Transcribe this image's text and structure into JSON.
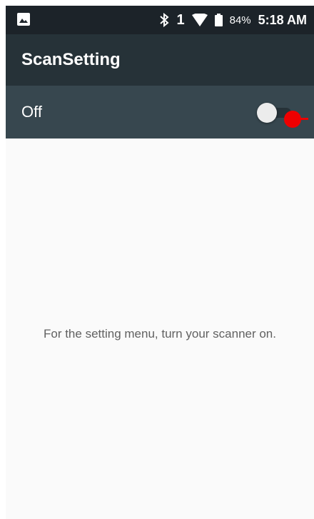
{
  "status_bar": {
    "notification_icon": "gallery-icon",
    "bluetooth_icon": "bluetooth-icon",
    "sim_number": "1",
    "wifi_icon": "wifi-icon",
    "battery_icon": "battery-icon",
    "battery": "84%",
    "time": "5:18 AM"
  },
  "app_bar": {
    "title": "ScanSetting"
  },
  "scanner_switch": {
    "label": "Off",
    "checked": false
  },
  "content": {
    "message": "For the setting menu, turn your scanner on."
  },
  "colors": {
    "status_bar": "#1c2329",
    "app_bar": "#263238",
    "switch_bar": "#37474f",
    "background": "#fafafa",
    "message_text": "#616161",
    "touch_indicator": "#ee0000"
  }
}
